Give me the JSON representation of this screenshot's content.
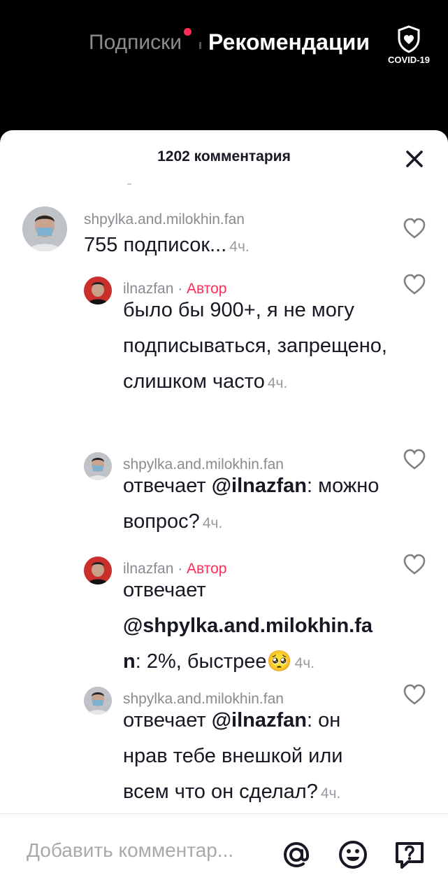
{
  "header": {
    "tab_following": "Подписки",
    "tab_foryou": "Рекомендации",
    "covid_label": "COVID-19"
  },
  "sheet": {
    "title": "1202 комментария"
  },
  "comments": [
    {
      "user": "shpylka.and.milokhin.fan",
      "author_badge": "",
      "prefix": "",
      "mention": "",
      "text": "755 подписок...",
      "time": "4ч."
    },
    {
      "user": "ilnazfan · ",
      "author_badge": "Автор",
      "prefix": "",
      "mention": "",
      "text": "было бы 900+, я не могу подписываться, запрещено, слишком часто",
      "time": "4ч."
    },
    {
      "user": "shpylka.and.milokhin.fan",
      "author_badge": "",
      "prefix": "отвечает ",
      "mention": "@ilnazfan",
      "text": ": можно вопрос?",
      "time": "4ч."
    },
    {
      "user": "ilnazfan · ",
      "author_badge": "Автор",
      "prefix": "отвечает ",
      "mention": "@shpylka.and.milokhin.fan",
      "text": ": 2%, быстрее🥺",
      "time": "4ч."
    },
    {
      "user": "shpylka.and.milokhin.fan",
      "author_badge": "",
      "prefix": "отвечает ",
      "mention": "@ilnazfan",
      "text": ": он нрав тебе внешкой или всем что он сделал?",
      "time": "4ч."
    }
  ],
  "composer": {
    "placeholder": "Добавить комментар..."
  },
  "icons": {
    "mention": "at-icon",
    "emoji": "emoji-icon",
    "question": "question-icon",
    "like": "heart-icon",
    "close": "close-icon",
    "covid": "shield-heart-icon"
  },
  "colors": {
    "accent": "#fe2c55",
    "text": "#161823",
    "muted": "#8a8b91"
  }
}
